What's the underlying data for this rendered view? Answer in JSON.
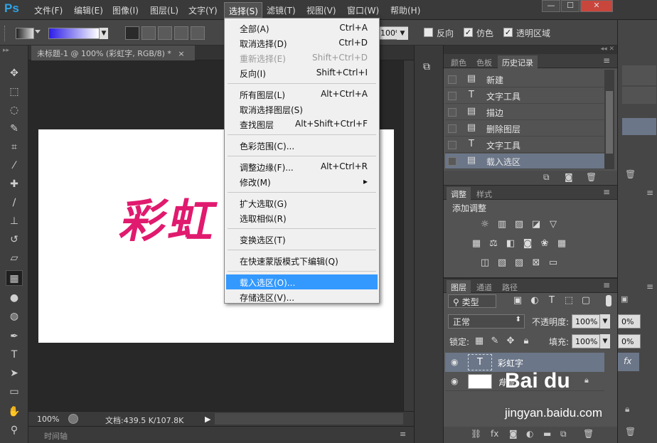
{
  "app": {
    "logo": "Ps"
  },
  "menubar": {
    "items": [
      "文件(F)",
      "编辑(E)",
      "图像(I)",
      "图层(L)",
      "文字(Y)",
      "选择(S)",
      "滤镜(T)",
      "视图(V)",
      "窗口(W)",
      "帮助(H)"
    ],
    "window_buttons": [
      "—",
      "☐",
      "✕"
    ]
  },
  "options": {
    "gradient_colors": {
      "start": "#2c1de8",
      "end": "#ffffff"
    },
    "opacity": "100%",
    "checkboxes": [
      {
        "label": "反向",
        "checked": false
      },
      {
        "label": "仿色",
        "checked": true
      },
      {
        "label": "透明区域",
        "checked": true
      }
    ]
  },
  "document": {
    "tab_title": "未标题-1 @ 100% (彩虹字, RGB/8) *",
    "tab_close": "×",
    "canvas_text": "彩虹",
    "text_color": "#e01a6e"
  },
  "status": {
    "zoom": "100%",
    "doc_info": "文档:439.5 K/107.8K",
    "timeline": "时间轴"
  },
  "history_panel": {
    "tabs": [
      "颜色",
      "色板",
      "历史记录"
    ],
    "items": [
      {
        "label": "新建",
        "icon": "doc-icon"
      },
      {
        "label": "文字工具",
        "icon": "text-icon"
      },
      {
        "label": "描边",
        "icon": "doc-icon"
      },
      {
        "label": "删除图层",
        "icon": "doc-icon"
      },
      {
        "label": "文字工具",
        "icon": "text-icon"
      },
      {
        "label": "载入选区",
        "icon": "doc-icon",
        "selected": true
      }
    ]
  },
  "adjustments_panel": {
    "tabs": [
      "调整",
      "样式"
    ],
    "title": "添加调整"
  },
  "layers_panel": {
    "tabs": [
      "图层",
      "通道",
      "路径"
    ],
    "filter_kind": "类型",
    "blend_mode": "正常",
    "opacity_label": "不透明度:",
    "opacity_value": "100%",
    "lock_label": "锁定:",
    "fill_label": "填充:",
    "fill_value": "100%",
    "layers": [
      {
        "name": "彩虹字",
        "type": "text",
        "selected": true
      },
      {
        "name": "背景",
        "type": "background",
        "locked": true
      }
    ]
  },
  "right_panel": {
    "opacity_a": "0%",
    "opacity_b": "0%",
    "fx": "fx"
  },
  "select_menu": {
    "groups": [
      [
        {
          "label": "全部(A)",
          "shortcut": "Ctrl+A"
        },
        {
          "label": "取消选择(D)",
          "shortcut": "Ctrl+D"
        },
        {
          "label": "重新选择(E)",
          "shortcut": "Shift+Ctrl+D",
          "disabled": true
        },
        {
          "label": "反向(I)",
          "shortcut": "Shift+Ctrl+I"
        }
      ],
      [
        {
          "label": "所有图层(L)",
          "shortcut": "Alt+Ctrl+A"
        },
        {
          "label": "取消选择图层(S)",
          "shortcut": ""
        },
        {
          "label": "查找图层",
          "shortcut": "Alt+Shift+Ctrl+F"
        }
      ],
      [
        {
          "label": "色彩范围(C)...",
          "shortcut": ""
        }
      ],
      [
        {
          "label": "调整边缘(F)...",
          "shortcut": "Alt+Ctrl+R"
        },
        {
          "label": "修改(M)",
          "shortcut": "▸"
        }
      ],
      [
        {
          "label": "扩大选取(G)",
          "shortcut": ""
        },
        {
          "label": "选取相似(R)",
          "shortcut": ""
        }
      ],
      [
        {
          "label": "变换选区(T)",
          "shortcut": ""
        }
      ],
      [
        {
          "label": "在快速蒙版模式下编辑(Q)",
          "shortcut": ""
        }
      ],
      [
        {
          "label": "载入选区(O)...",
          "shortcut": "",
          "highlighted": true
        },
        {
          "label": "存储选区(V)...",
          "shortcut": ""
        }
      ]
    ]
  },
  "watermark": {
    "logo": "Bai du",
    "url": "jingyan.baidu.com"
  }
}
